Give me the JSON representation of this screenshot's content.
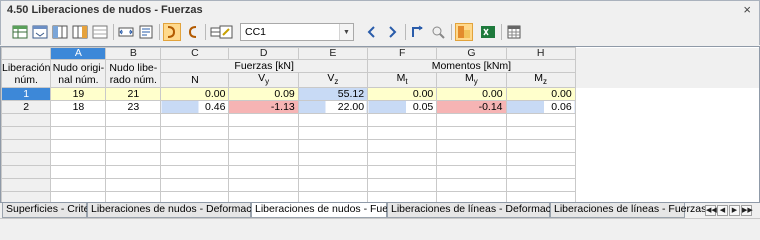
{
  "window": {
    "title": "4.50 Liberaciones de nudos - Fuerzas",
    "close_label": "×"
  },
  "toolbar": {
    "loadcase_value": "CC1",
    "icons": [
      "table-export-icon",
      "table-import-icon",
      "columns-left-icon",
      "columns-right-icon",
      "insert-row-icon",
      "delete-row-icon",
      "filter-icon",
      "filter-alt-icon",
      "options-icon",
      "edit-icon",
      "previous-icon",
      "next-icon",
      "pointer-icon",
      "view-icon",
      "color-scale-icon",
      "excel-icon",
      "calculator-icon"
    ]
  },
  "table": {
    "letters": [
      "A",
      "B",
      "C",
      "D",
      "E",
      "F",
      "G",
      "H"
    ],
    "row_header_title": [
      "Liberación",
      "núm."
    ],
    "col_a_title": [
      "Nudo origi-",
      "nal núm."
    ],
    "col_b_title": [
      "Nudo libe-",
      "rado núm."
    ],
    "group_forces": "Fuerzas [kN]",
    "group_moments": "Momentos [kNm]",
    "sub_headers": [
      "N",
      "Vy",
      "Vz",
      "Mt",
      "My",
      "Mz"
    ],
    "rows": [
      {
        "no": "1",
        "a": "19",
        "b": "21",
        "c": "0.00",
        "d": "0.09",
        "e": "55.12",
        "f": "0.00",
        "g": "0.00",
        "h": "0.00"
      },
      {
        "no": "2",
        "a": "18",
        "b": "23",
        "c": "0.46",
        "d": "-1.13",
        "e": "22.00",
        "f": "0.05",
        "g": "-0.14",
        "h": "0.06"
      }
    ]
  },
  "tabs": [
    "Superficies - Criterio",
    "Liberaciones de nudos - Deformaciones",
    "Liberaciones de nudos - Fuerzas",
    "Liberaciones de líneas - Deformaciones",
    "Liberaciones de líneas - Fuerzas"
  ],
  "active_tab": "Liberaciones de nudos - Fuerzas",
  "tab_nav": [
    "◀◀",
    "◀",
    "▶",
    "▶▶"
  ],
  "colors": {
    "selection": "#3d88d8",
    "highlight_row": "#ffffcc",
    "positive_bar": "#c8daf5",
    "negative_bar": "#f6b4b4"
  },
  "value_bars": {
    "c": [
      0,
      0.46
    ],
    "d": [
      0,
      1
    ],
    "e": [
      1,
      0.4
    ],
    "f": [
      0,
      0.5
    ],
    "g": [
      0,
      0.5
    ],
    "h": [
      0,
      0.5
    ]
  }
}
